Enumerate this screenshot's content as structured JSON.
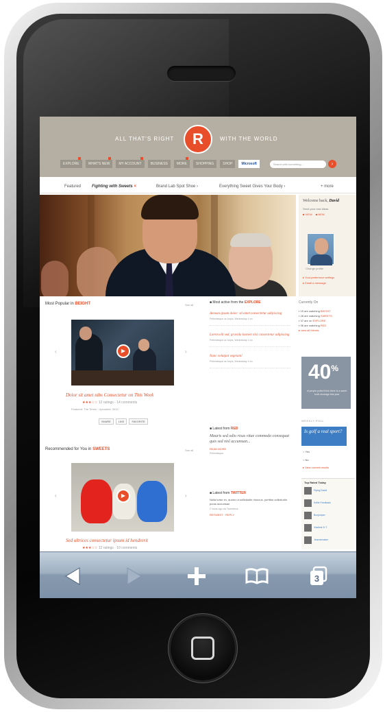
{
  "site": {
    "tagline_left": "ALL THAT'S RIGHT",
    "tagline_right": "WITH THE WORLD",
    "logo_letter": "R",
    "nav": [
      "EXPLORE",
      "WHAT'S NEW",
      "MY ACCOUNT",
      "BUSINESS",
      "MORE",
      "SHOPPING",
      "SHOP"
    ],
    "nav_brand": "Microsoft",
    "search_placeholder": "Search with something...",
    "search_icon": "arrow-right-icon"
  },
  "tabs": {
    "items": [
      "Featured",
      "Fighting with Sweets",
      "Brand Lab Spot Shoe",
      "Everything Sweet Gives Your Body"
    ],
    "more": "+ more"
  },
  "user_panel": {
    "greeting": "Welcome back,",
    "name": "David",
    "small": "Send your new ideas",
    "link_view": "VIEW",
    "link_new": "NEW",
    "avatar_caption": "Change profile",
    "footer_link1": "Your preference settings",
    "footer_link2": "Email a message"
  },
  "most_popular": {
    "title_prefix": "Most Popular in",
    "title_highlight": "BEIGHT",
    "all": "See all",
    "video_title": "Dolor sit amet nibs Consectetur on This Week",
    "rating_meta": "12 ratings",
    "comments": "14 comments",
    "meta_line": "Featured: The Times · Uploaded: 2010 ·",
    "share": [
      "SHARE",
      "LIKE",
      "FAVORITE"
    ]
  },
  "most_active": {
    "title_prefix": "Most active from the",
    "title_highlight": "EXPLORE",
    "items": [
      {
        "head": "Aenean ipsum dolor: sit amet consectetur adipiscing",
        "sub": "Pellentesque ac turpis, Wednesday 4 on"
      },
      {
        "head": "Lorem elit sed, gravida laoreet nisi consectetur adipiscing",
        "sub": "Pellentesque ac turpis, Wednesday 4 on"
      },
      {
        "head": "Nunc volutpat vegetam!",
        "sub": "Pellentesque ac turpis, Wednesday 4 on"
      }
    ]
  },
  "recommended": {
    "title_prefix": "Recommended for You in",
    "title_highlight": "SWEETS",
    "all": "See all",
    "video_title": "Sed ultrices consectetur ipsum id hendrerit",
    "rating_meta": "12 ratings",
    "comments": "10 comments"
  },
  "latest_1": {
    "title_prefix": "Latest from",
    "title_highlight": "RED",
    "quote": "Mauris sed odio risus vitae commodo consequat quis sed nisl accumsan...",
    "link": "READ MORE",
    "meta": "Pellentesque"
  },
  "latest_2": {
    "title_prefix": "Latest from",
    "title_highlight": "TWITTER",
    "text": "Nulla tortor ex, auctor ut sollicitudin rhoncus, porttitor sollicitudin purus accumsan",
    "meta": "2 hours ago via Tweetdeck",
    "link": "RETWEET · REPLY"
  },
  "currently_on": {
    "title": "Currently On",
    "items": [
      {
        "count": "15",
        "label": "are watching",
        "where": "BEIGHT"
      },
      {
        "count": "28",
        "label": "are watching",
        "where": "SWEETS"
      },
      {
        "count": "37",
        "label": "are on",
        "where": "EXPLORE"
      },
      {
        "count": "96",
        "label": "are watching",
        "where": "RED"
      }
    ],
    "more": "view all friends"
  },
  "stat": {
    "value": "40",
    "suffix": "%",
    "caption": "of people polled think there is a sweet tooth shortage this year"
  },
  "poll": {
    "title": "WEEKLY POLL",
    "question": "Is golf a real sport?",
    "options": [
      "Yes",
      "No"
    ],
    "link": "View current results"
  },
  "fans": {
    "title": "Top Rated Today",
    "items": [
      "Flying David",
      "Kellie Feedback",
      "Boxjumper",
      "Vladimir D.T.",
      "Jeannemaker"
    ]
  },
  "toolbar": {
    "pages_count": "3"
  }
}
